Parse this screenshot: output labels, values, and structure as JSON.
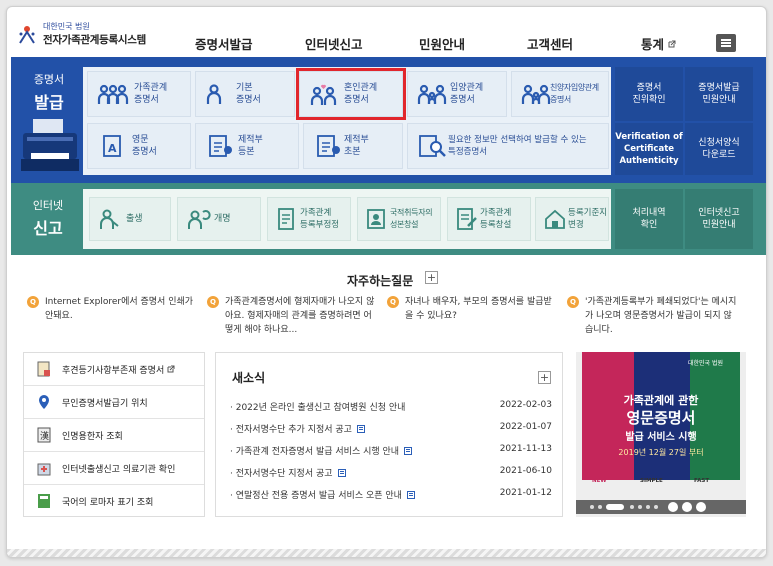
{
  "header": {
    "logo_small": "대한민국 법원",
    "logo_title": "전자가족관계등록시스템",
    "nav": [
      "증명서발급",
      "인터넷신고",
      "민원안내",
      "고객센터",
      "통계"
    ]
  },
  "issue": {
    "title_small": "증명서",
    "title_big": "발급",
    "cards": [
      "가족관계\n증명서",
      "기본\n증명서",
      "혼인관계\n증명서",
      "입양관계\n증명서",
      "친양자입양관계\n증명서",
      "영문\n증명서",
      "제적부\n등본",
      "제적부\n초본",
      "필요한 정보만 선택하여 발급할 수 있는\n특정증명서"
    ],
    "side": [
      "증명서\n진위확인",
      "증명서발급\n민원안내",
      "Verification of\nCertificate\nAuthenticity",
      "신청서양식\n다운로드"
    ]
  },
  "report": {
    "title_small": "인터넷",
    "title_big": "신고",
    "cards": [
      "출생",
      "개명",
      "가족관계\n등록부정정",
      "국적취득자의\n성본창설",
      "가족관계\n등록창설",
      "등록기준지\n변경"
    ],
    "side": [
      "처리내역\n확인",
      "인터넷신고\n민원안내"
    ]
  },
  "faq": {
    "title": "자주하는질문",
    "plus": "+",
    "badge": "Q",
    "items": [
      "Internet Explorer에서 증명서 인쇄가 안돼요.",
      "가족관계증명서에 형제자매가 나오지 않아요. 형제자매의 관계를 증명하려면 어떻게 해야 하나요...",
      "자녀나 배우자, 부모의 증명서를 발급받을 수 있나요?",
      "'가족관계등록부가 폐쇄되었다'는 메시지가 나오며 영문증명서가 발급이 되지 않습니다."
    ]
  },
  "links": [
    "후견등기사항부존재 증명서",
    "무인증명서발급기 위치",
    "인명용한자 조회",
    "인터넷출생신고 의료기관 확인",
    "국어의 로마자 표기 조회"
  ],
  "news": {
    "title": "새소식",
    "plus": "+",
    "items": [
      {
        "text": "2022년 온라인 출생신고 참여병원 신청 안내",
        "date": "2022-02-03"
      },
      {
        "text": "전자서명수단 추가 지정서 공고",
        "date": "2022-01-07"
      },
      {
        "text": "가족관계 전자증명서 발급 서비스 시행 안내",
        "date": "2021-11-13"
      },
      {
        "text": "전자서명수단 지정서 공고",
        "date": "2021-06-10"
      },
      {
        "text": "연말정산 전용 증명서 발급 서비스 오픈 안내",
        "date": "2021-01-12"
      }
    ]
  },
  "banner": {
    "org": "대한민국 법원",
    "line1": "가족관계에 관한",
    "line2": "영문증명서",
    "line3": "발급 서비스 시행",
    "date": "2019년 12월 27일 부터",
    "tags": [
      "NEW",
      "SIMPLE",
      "FAST"
    ]
  },
  "colors": {
    "issue_band": "#2251a8",
    "report_band": "#3e8c82",
    "highlight": "#e1262c",
    "faq_badge": "#f2a33a"
  }
}
